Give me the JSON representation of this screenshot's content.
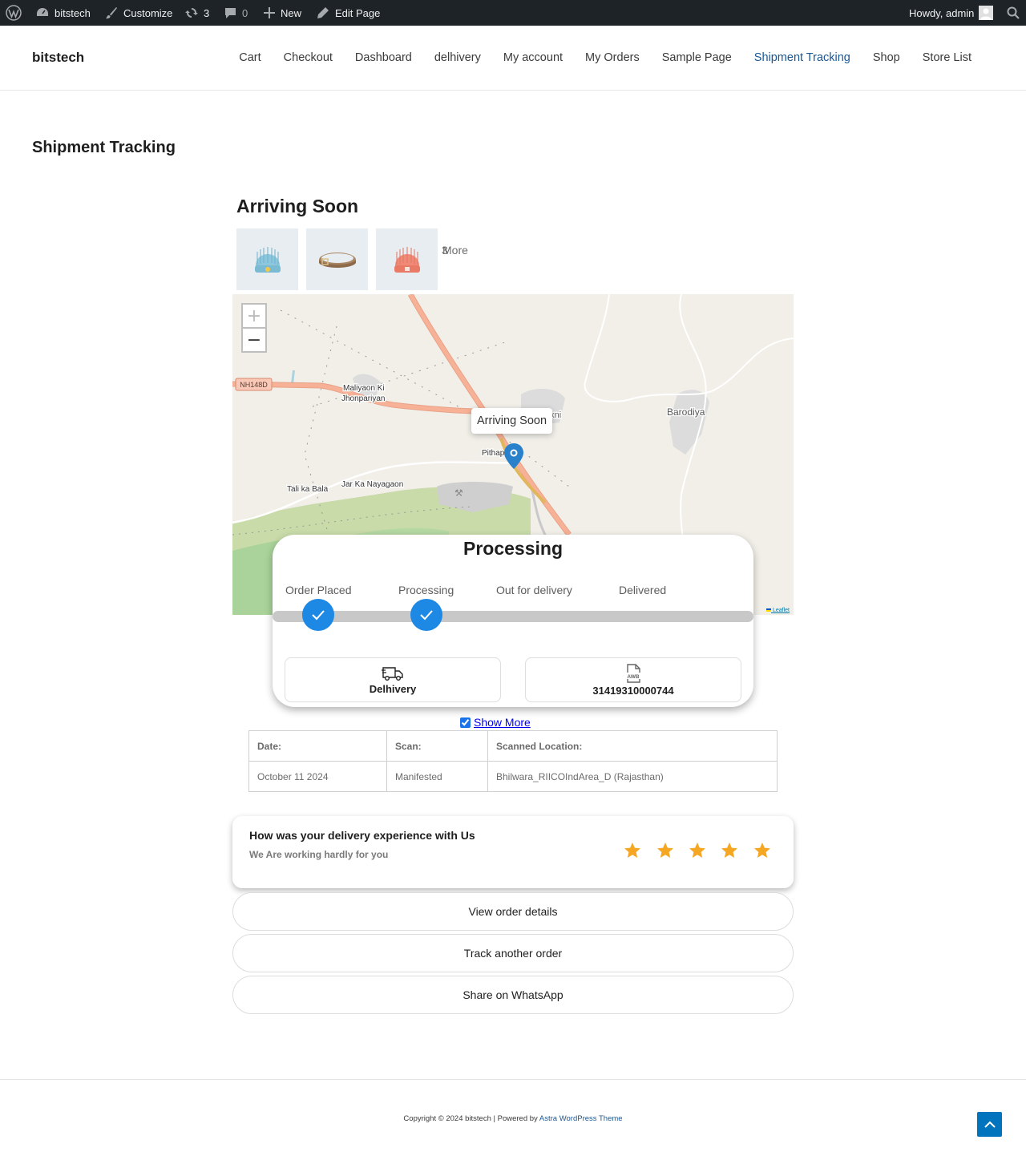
{
  "adminbar": {
    "site_name": "bitstech",
    "customize": "Customize",
    "updates_count": "3",
    "comments_count": "0",
    "new": "New",
    "edit_page": "Edit Page",
    "howdy": "Howdy, admin"
  },
  "header": {
    "site_title": "bitstech",
    "nav": [
      "Cart",
      "Checkout",
      "Dashboard",
      "delhivery",
      "My account",
      "My Orders",
      "Sample Page",
      "Shipment Tracking",
      "Shop",
      "Store List"
    ],
    "active_nav": "Shipment Tracking",
    "active_color": "#1a5794"
  },
  "page": {
    "title": "Shipment Tracking"
  },
  "tracking": {
    "heading": "Arriving Soon",
    "products": [
      "blue-beanie",
      "leather-belt",
      "red-beanie"
    ],
    "more_label": "More",
    "more_count": "3",
    "map": {
      "zoom_in": "+",
      "zoom_out": "−",
      "popup": "Arriving Soon",
      "attribution": "Leaflet",
      "labels": {
        "road": "NH148D",
        "village1_line1": "Maliyaon Ki",
        "village1_line2": "Jhonpariyan",
        "village2": "Dhakni",
        "village3": "Barodiya",
        "village4": "Pithap",
        "village5": "Tali ka Bala",
        "village6": "Jar Ka Nayagaon"
      }
    },
    "status": {
      "title": "Processing",
      "steps": [
        "Order Placed",
        "Processing",
        "Out for delivery",
        "Delivered"
      ],
      "completed_steps": 2,
      "accent": "#1e88e5",
      "courier": "Delhivery",
      "awb": "31419310000744"
    },
    "show_more": "Show More",
    "scan_table": {
      "headers": [
        "Date:",
        "Scan:",
        "Scanned Location:"
      ],
      "rows": [
        [
          "October 11 2024",
          "Manifested",
          "Bhilwara_RIICOIndArea_D (Rajasthan)"
        ]
      ]
    }
  },
  "feedback": {
    "title": "How was your delivery experience with Us",
    "subtitle": "We Are working hardly for you",
    "stars": 5,
    "star_color": "#f5a623"
  },
  "actions": [
    "View order details",
    "Track another order",
    "Share on WhatsApp"
  ],
  "footer": {
    "text": "Copyright © 2024 bitstech | Powered by ",
    "theme_link": "Astra WordPress Theme"
  }
}
